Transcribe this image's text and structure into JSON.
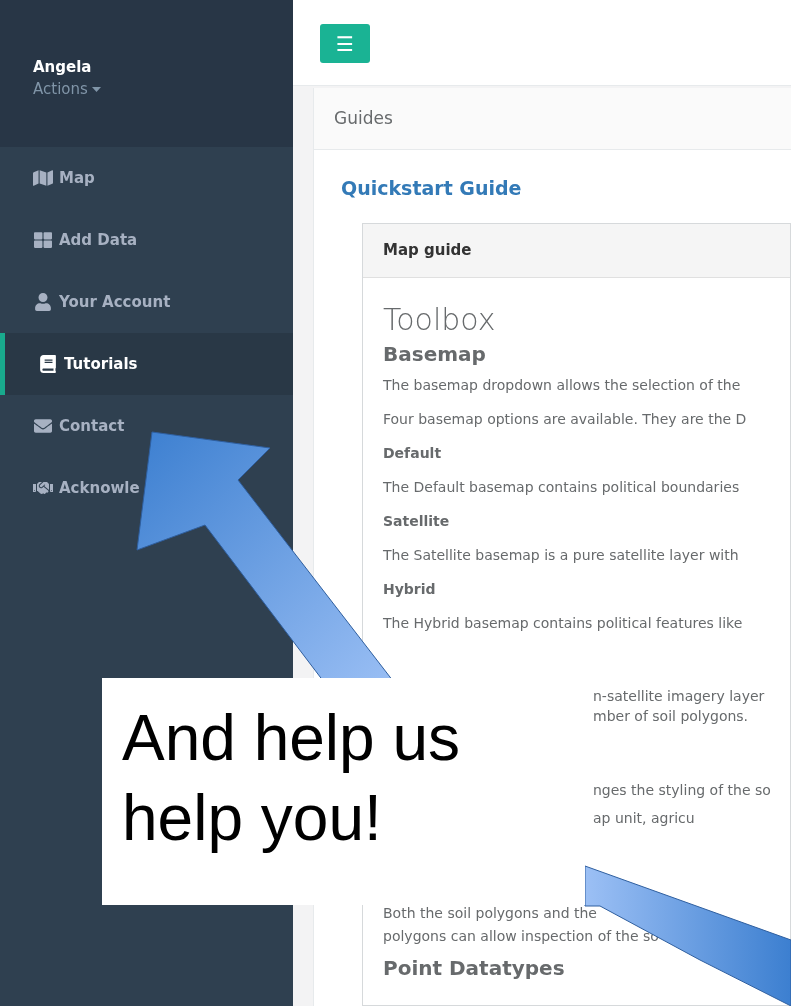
{
  "sidebar": {
    "user": {
      "name": "Angela",
      "menu": "Actions"
    },
    "items": [
      {
        "label": "Map",
        "selected": false
      },
      {
        "label": "Add Data",
        "selected": false
      },
      {
        "label": "Your Account",
        "selected": false
      },
      {
        "label": "Tutorials",
        "selected": true
      },
      {
        "label": "Contact",
        "selected": false
      },
      {
        "label": "Acknowle",
        "selected": false
      }
    ]
  },
  "toolbar": {
    "menu_button": "☰"
  },
  "panel": {
    "title": "Guides",
    "link": "Quickstart Guide",
    "card": {
      "title": "Map guide",
      "blocks": [
        {
          "kind": "title",
          "text": "Toolbox"
        },
        {
          "kind": "heading",
          "text": "Basemap"
        },
        {
          "kind": "text",
          "text": "The basemap dropdown allows the selection of the"
        },
        {
          "kind": "text",
          "text": "Four basemap options are available. They are the D"
        },
        {
          "kind": "label",
          "text": "Default"
        },
        {
          "kind": "text",
          "text": "The Default basemap contains political boundaries"
        },
        {
          "kind": "label",
          "text": "Satellite"
        },
        {
          "kind": "text",
          "text": "The Satellite basemap is a pure satellite layer with"
        },
        {
          "kind": "label",
          "text": "Hybrid"
        },
        {
          "kind": "text",
          "text": "The Hybrid basemap contains political features like"
        }
      ],
      "beside_callout": [
        [
          "n-satellite imagery layer",
          "mber of soil polygons."
        ],
        [
          "nges the styling of the so",
          "ap unit, agricu"
        ]
      ],
      "below_callout": [
        "Both the soil polygons and the",
        "polygons can allow inspection of the so"
      ],
      "last_heading": "Point Datatypes"
    }
  },
  "callout": {
    "text": "And help us help you!"
  }
}
